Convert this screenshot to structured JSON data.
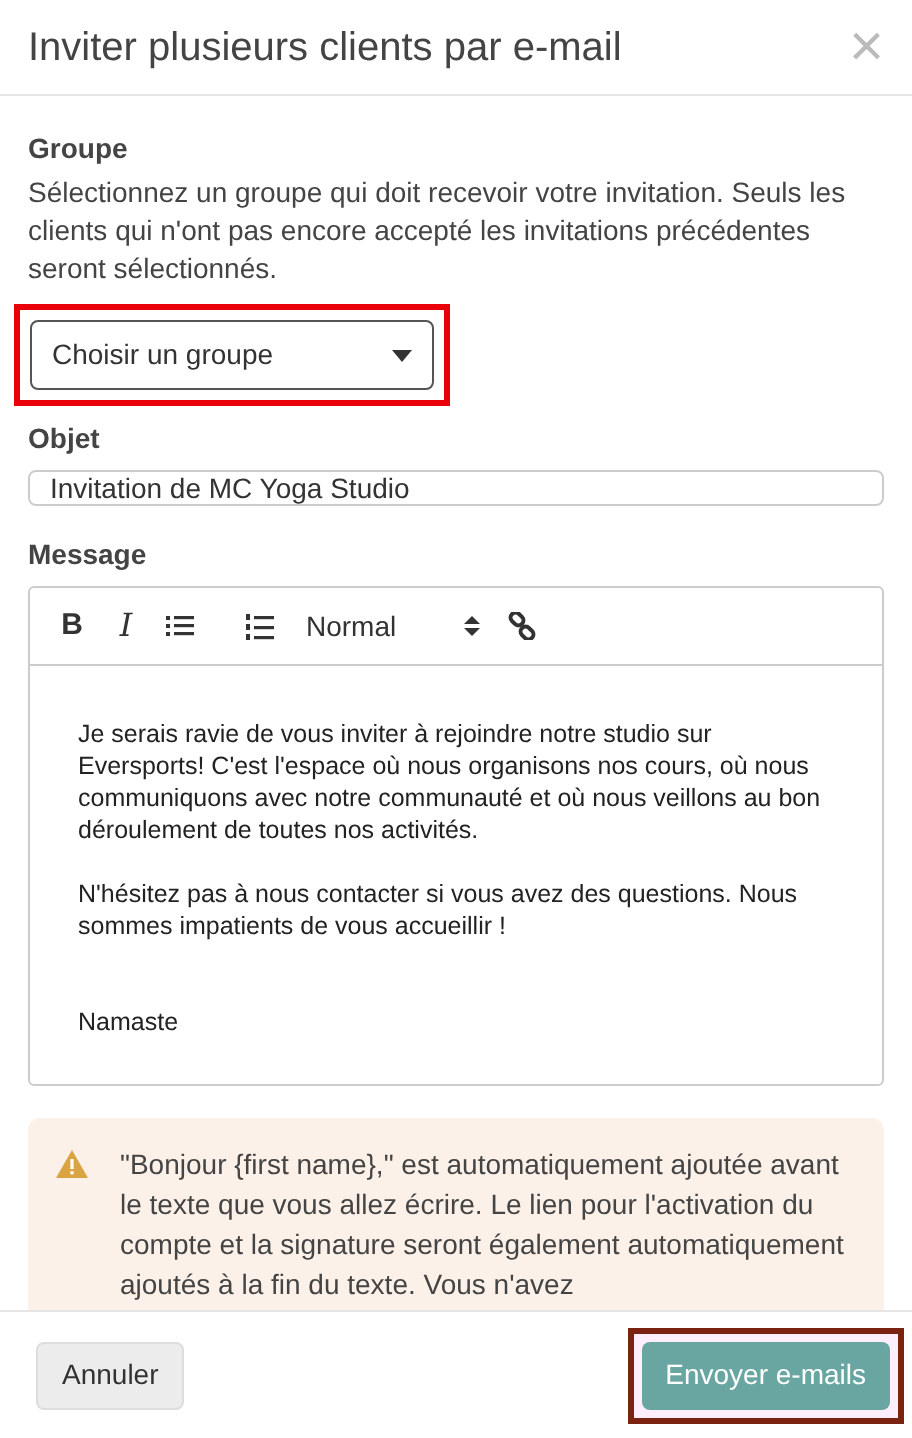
{
  "dialog": {
    "title": "Inviter plusieurs clients par e-mail",
    "close": "×"
  },
  "group": {
    "label": "Groupe",
    "help": "Sélectionnez un groupe qui doit recevoir votre invitation. Seuls les clients qui n'ont pas encore accepté les invitations précédentes seront sélectionnés.",
    "value": "Choisir un groupe",
    "highlighted": true
  },
  "subject": {
    "label": "Objet",
    "value": "Invitation de MC Yoga Studio"
  },
  "message": {
    "label": "Message",
    "toolbar": [
      {
        "kind": "bold",
        "text": "B"
      },
      {
        "kind": "italic",
        "text": "I"
      },
      {
        "kind": "bullets"
      },
      {
        "kind": "numbers"
      },
      {
        "kind": "format",
        "text": "Normal"
      },
      {
        "kind": "link"
      }
    ],
    "paragraphs": [
      "Je serais ravie de vous inviter à rejoindre notre studio sur Eversports! C'est l'espace où nous organisons nos cours, où nous communiquons avec notre communauté et où nous veillons au bon déroulement de toutes nos activités.",
      "N'hésitez pas à nous contacter si vous avez des questions. Nous sommes impatients de vous accueillir !",
      "Namaste"
    ]
  },
  "notice": {
    "text": "\"Bonjour {first name},\" est automatiquement ajoutée avant le texte que vous allez écrire. Le lien pour l'activation du compte et la signature seront également automatiquement ajoutés à la fin du texte. Vous n'avez"
  },
  "footer": {
    "cancel": "Annuler",
    "submit": {
      "label": "Envoyer e-mails",
      "highlighted": true
    }
  }
}
